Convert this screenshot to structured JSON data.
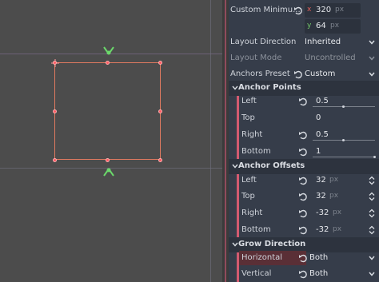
{
  "inspector": {
    "custom_minimum_size": {
      "label": "Custom Minimu...",
      "x_axis": "x",
      "x_value": "320",
      "y_axis": "y",
      "y_value": "64",
      "unit": "px"
    },
    "layout_direction": {
      "label": "Layout Direction",
      "value": "Inherited"
    },
    "layout_mode": {
      "label": "Layout Mode",
      "value": "Uncontrolled"
    },
    "anchors_preset": {
      "label": "Anchors Preset",
      "value": "Custom"
    },
    "anchor_points": {
      "title": "Anchor Points",
      "left": {
        "label": "Left",
        "value": "0.5",
        "slider": 0.5
      },
      "top": {
        "label": "Top",
        "value": "0"
      },
      "right": {
        "label": "Right",
        "value": "0.5",
        "slider": 0.5
      },
      "bottom": {
        "label": "Bottom",
        "value": "1",
        "slider": 1.0
      }
    },
    "anchor_offsets": {
      "title": "Anchor Offsets",
      "unit": "px",
      "left": {
        "label": "Left",
        "value": "32"
      },
      "top": {
        "label": "Top",
        "value": "32"
      },
      "right": {
        "label": "Right",
        "value": "-32"
      },
      "bottom": {
        "label": "Bottom",
        "value": "-32"
      }
    },
    "grow_direction": {
      "title": "Grow Direction",
      "horizontal": {
        "label": "Horizontal",
        "value": "Both"
      },
      "vertical": {
        "label": "Vertical",
        "value": "Both"
      }
    }
  },
  "colors": {
    "accent": "#d35a70",
    "selection_rect": "#e07a60",
    "handle": "#ff5a64",
    "anchor_pin": "#6bd86b",
    "axis_x": "#e0605a",
    "axis_y": "#73c96a"
  },
  "icons": [
    "revert-icon",
    "chevron-down-icon",
    "updown-arrows-icon",
    "anchor-pin-icon",
    "section-caret-icon"
  ]
}
